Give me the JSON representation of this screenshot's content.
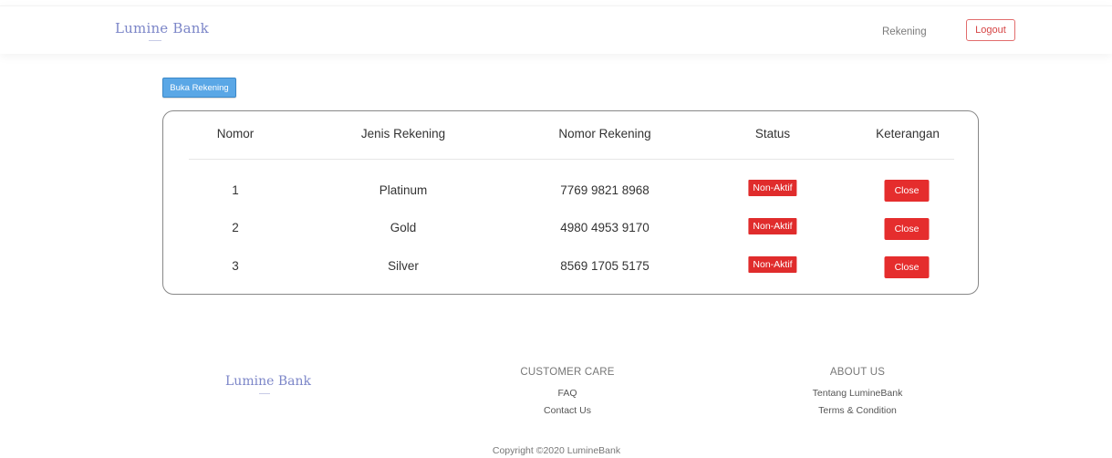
{
  "navbar": {
    "brand": "Lumine Bank",
    "links": [
      "Rekening"
    ],
    "logout_label": "Logout"
  },
  "actions": {
    "open_account_label": "Buka Rekening"
  },
  "table": {
    "headers": [
      "Nomor",
      "Jenis Rekening",
      "Nomor Rekening",
      "Status",
      "Keterangan"
    ],
    "rows": [
      {
        "no": "1",
        "type": "Platinum",
        "account": "7769 9821 8968",
        "status": "Non-Aktif",
        "action": "Close"
      },
      {
        "no": "2",
        "type": "Gold",
        "account": "4980 4953 9170",
        "status": "Non-Aktif",
        "action": "Close"
      },
      {
        "no": "3",
        "type": "Silver",
        "account": "8569 1705 5175",
        "status": "Non-Aktif",
        "action": "Close"
      }
    ]
  },
  "footer": {
    "brand": "Lumine Bank",
    "customer_care": {
      "title": "CUSTOMER CARE",
      "links": [
        "FAQ",
        "Contact Us"
      ]
    },
    "about_us": {
      "title": "ABOUT US",
      "links": [
        "Tentang LumineBank",
        "Terms & Condition"
      ]
    },
    "copyright": "Copyright ©2020 LumineBank"
  },
  "colors": {
    "brand": "#7c86c8",
    "primary_button": "#5aa7e6",
    "danger": "#e02c2c"
  }
}
